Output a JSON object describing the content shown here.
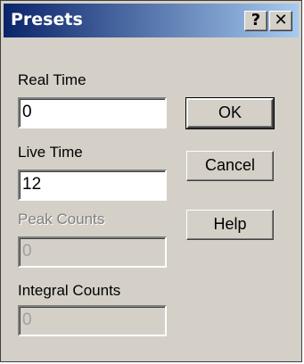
{
  "window": {
    "title": "Presets",
    "help_glyph": "?",
    "close_glyph": "✕"
  },
  "fields": {
    "real_time": {
      "label": "Real Time",
      "value": "0"
    },
    "live_time": {
      "label": "Live Time",
      "value": "12"
    },
    "peak_counts": {
      "label": "Peak Counts",
      "value": "0"
    },
    "integral_counts": {
      "label": "Integral Counts",
      "value": "0"
    }
  },
  "buttons": {
    "ok": "OK",
    "cancel": "Cancel",
    "help": "Help"
  }
}
